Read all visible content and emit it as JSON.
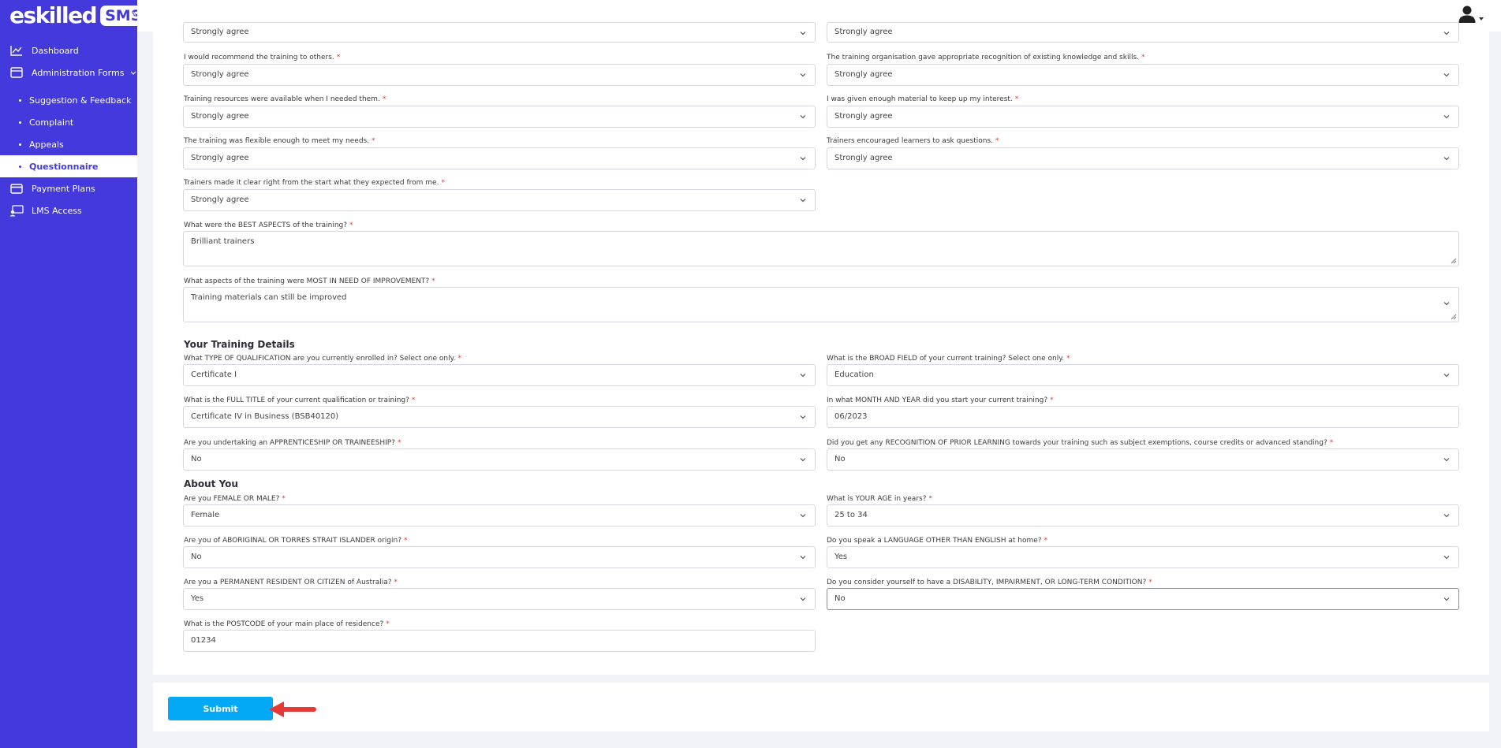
{
  "brand": {
    "name": "eskilled",
    "badge": "SMS"
  },
  "sidebar": {
    "dashboard": "Dashboard",
    "admin_forms": "Administration Forms",
    "sub": [
      "Suggestion & Feedback",
      "Complaint",
      "Appeals",
      "Questionnaire"
    ],
    "payment_plans": "Payment Plans",
    "lms_access": "LMS Access"
  },
  "colors": {
    "sidebar": "#4339dd",
    "accent": "#03a9f4",
    "arrow": "#e53935"
  },
  "form": {
    "top_left": "Strongly agree",
    "top_right": "Strongly agree",
    "recommend": {
      "label": "I would recommend the training to others.",
      "value": "Strongly agree"
    },
    "recognition": {
      "label": "The training organisation gave appropriate recognition of existing knowledge and skills.",
      "value": "Strongly agree"
    },
    "resources": {
      "label": "Training resources were available when I needed them.",
      "value": "Strongly agree"
    },
    "material": {
      "label": "I was given enough material to keep up my interest.",
      "value": "Strongly agree"
    },
    "flexible": {
      "label": "The training was flexible enough to meet my needs.",
      "value": "Strongly agree"
    },
    "encouraged": {
      "label": "Trainers encouraged learners to ask questions.",
      "value": "Strongly agree"
    },
    "clear": {
      "label": "Trainers made it clear right from the start what they expected from me.",
      "value": "Strongly agree"
    },
    "best": {
      "label": "What were the BEST ASPECTS of the training?",
      "value": "Brilliant trainers"
    },
    "improve": {
      "label": "What aspects of the training were MOST IN NEED OF IMPROVEMENT?",
      "value": "Training materials can still be improved"
    },
    "training_details_title": "Your Training Details",
    "qual_type": {
      "label": "What TYPE OF QUALIFICATION are you currently enrolled in? Select one only.",
      "value": "Certificate I"
    },
    "broad_field": {
      "label": "What is the BROAD FIELD of your current training? Select one only.",
      "value": "Education"
    },
    "full_title": {
      "label": "What is the FULL TITLE of your current qualification or training?",
      "value": "Certificate IV in Business (BSB40120)"
    },
    "start_date": {
      "label": "In what MONTH AND YEAR did you start your current training?",
      "value": "06/2023"
    },
    "apprenticeship": {
      "label": "Are you undertaking an APPRENTICESHIP OR TRAINEESHIP?",
      "value": "No"
    },
    "rpl": {
      "label": "Did you get any RECOGNITION OF PRIOR LEARNING towards your training such as subject exemptions, course credits or advanced standing?",
      "value": "No"
    },
    "about_title": "About You",
    "gender": {
      "label": "Are you FEMALE OR MALE?",
      "value": "Female"
    },
    "age": {
      "label": "What is YOUR AGE in years?",
      "value": "25 to 34"
    },
    "aboriginal": {
      "label": "Are you of ABORIGINAL OR TORRES STRAIT ISLANDER origin?",
      "value": "No"
    },
    "language": {
      "label": "Do you speak a LANGUAGE OTHER THAN ENGLISH at home?",
      "value": "Yes"
    },
    "resident": {
      "label": "Are you a PERMANENT RESIDENT OR CITIZEN of Australia?",
      "value": "Yes"
    },
    "disability": {
      "label": "Do you consider yourself to have a DISABILITY, IMPAIRMENT, OR LONG-TERM CONDITION?",
      "value": "No"
    },
    "postcode": {
      "label": "What is the POSTCODE of your main place of residence?",
      "value": "01234"
    },
    "required_mark": "*"
  },
  "submit_label": "Submit"
}
